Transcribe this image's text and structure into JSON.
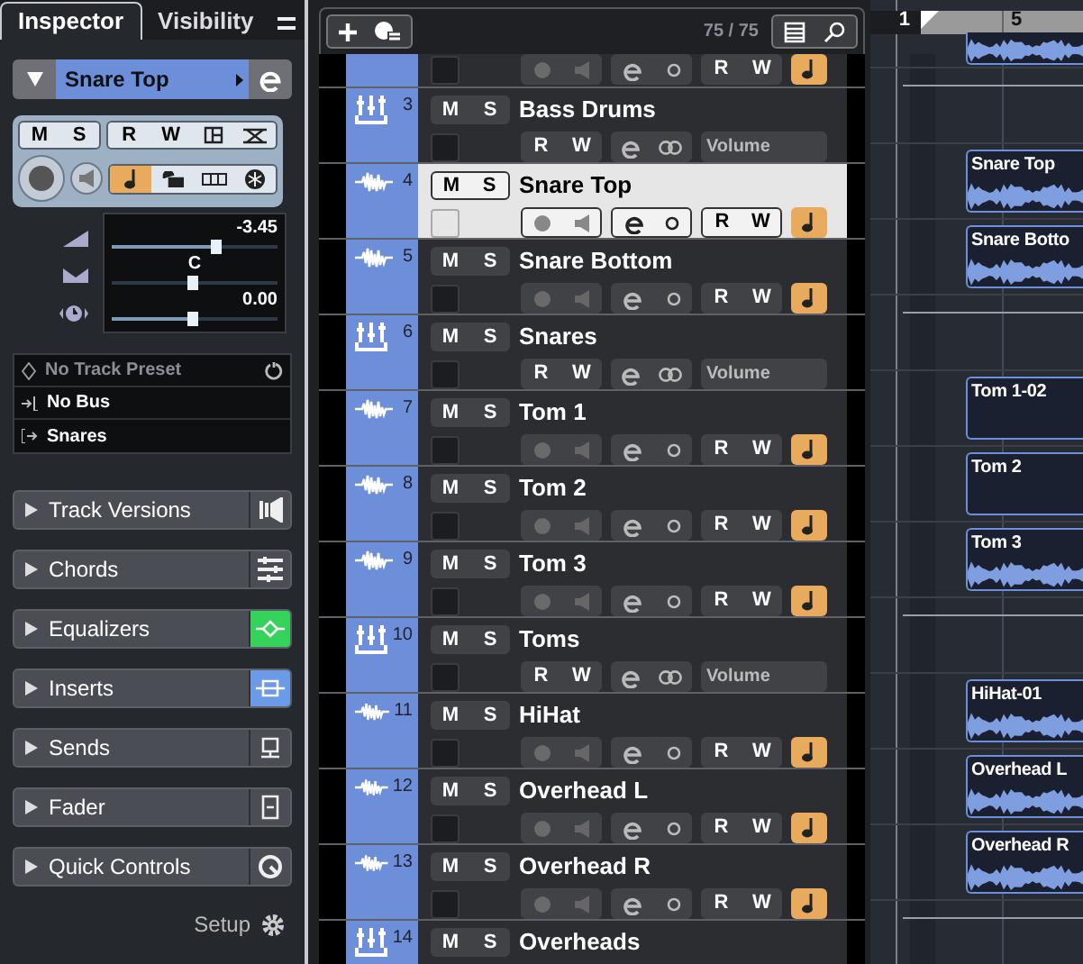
{
  "inspector": {
    "tabs": [
      {
        "label": "Inspector",
        "selected": true
      },
      {
        "label": "Visibility",
        "selected": false
      }
    ],
    "track_name": "Snare Top",
    "controls": {
      "m": "M",
      "s": "S",
      "r": "R",
      "w": "W",
      "musical": true
    },
    "volume": {
      "reading": "-3.45",
      "level": 0.63
    },
    "pan": {
      "reading": "C",
      "level": 0.49
    },
    "delay": {
      "reading": "0.00",
      "level": 0.49
    },
    "routing": [
      {
        "kind": "preset",
        "label": "No Track Preset"
      },
      {
        "kind": "input",
        "label": "No Bus"
      },
      {
        "kind": "output",
        "label": "Snares"
      }
    ],
    "sections": [
      {
        "label": "Track Versions"
      },
      {
        "label": "Chords"
      },
      {
        "label": "Equalizers",
        "color": "#35d35c"
      },
      {
        "label": "Inserts",
        "color": "#6b9ae6"
      },
      {
        "label": "Sends"
      },
      {
        "label": "Fader"
      },
      {
        "label": "Quick Controls"
      }
    ],
    "setup": "Setup"
  },
  "track_list": {
    "count": "75 / 75",
    "tracks": [
      {
        "kind": "audio",
        "r": "R",
        "w": "W",
        "musical": true,
        "selected": false,
        "event": {
          "waveform": true
        }
      },
      {
        "kind": "group",
        "number": "3",
        "name": "Bass Drums",
        "m": "M",
        "s": "S",
        "r": "R",
        "w": "W",
        "automation": "Volume",
        "selected": false
      },
      {
        "kind": "audio",
        "number": "4",
        "name": "Snare Top",
        "m": "M",
        "s": "S",
        "r": "R",
        "w": "W",
        "musical": true,
        "selected": true,
        "event": {
          "label": "Snare Top",
          "waveform": true
        }
      },
      {
        "kind": "audio",
        "number": "5",
        "name": "Snare Bottom",
        "m": "M",
        "s": "S",
        "r": "R",
        "w": "W",
        "musical": true,
        "selected": false,
        "event": {
          "label": "Snare Botto",
          "waveform": true
        }
      },
      {
        "kind": "group",
        "number": "6",
        "name": "Snares",
        "m": "M",
        "s": "S",
        "r": "R",
        "w": "W",
        "automation": "Volume",
        "selected": false
      },
      {
        "kind": "audio",
        "number": "7",
        "name": "Tom 1",
        "m": "M",
        "s": "S",
        "r": "R",
        "w": "W",
        "musical": true,
        "selected": false,
        "event": {
          "label": "Tom 1-02",
          "waveform": false
        }
      },
      {
        "kind": "audio",
        "number": "8",
        "name": "Tom 2",
        "m": "M",
        "s": "S",
        "r": "R",
        "w": "W",
        "musical": true,
        "selected": false,
        "event": {
          "label": "Tom 2",
          "waveform": false
        }
      },
      {
        "kind": "audio",
        "number": "9",
        "name": "Tom 3",
        "m": "M",
        "s": "S",
        "r": "R",
        "w": "W",
        "musical": true,
        "selected": false,
        "event": {
          "label": "Tom 3",
          "waveform": true
        }
      },
      {
        "kind": "group",
        "number": "10",
        "name": "Toms",
        "m": "M",
        "s": "S",
        "r": "R",
        "w": "W",
        "automation": "Volume",
        "selected": false
      },
      {
        "kind": "audio",
        "number": "11",
        "name": "HiHat",
        "m": "M",
        "s": "S",
        "r": "R",
        "w": "W",
        "musical": true,
        "selected": false,
        "event": {
          "label": "HiHat-01",
          "waveform": true
        }
      },
      {
        "kind": "audio",
        "number": "12",
        "name": "Overhead L",
        "m": "M",
        "s": "S",
        "r": "R",
        "w": "W",
        "musical": true,
        "selected": false,
        "event": {
          "label": "Overhead L",
          "waveform": true
        }
      },
      {
        "kind": "audio",
        "number": "13",
        "name": "Overhead R",
        "m": "M",
        "s": "S",
        "r": "R",
        "w": "W",
        "musical": true,
        "selected": false,
        "event": {
          "label": "Overhead R",
          "waveform": true
        }
      },
      {
        "kind": "group",
        "number": "14",
        "name": "Overheads",
        "m": "M",
        "s": "S",
        "selected": false
      }
    ]
  },
  "arrange": {
    "ruler": [
      "1",
      "5"
    ]
  }
}
